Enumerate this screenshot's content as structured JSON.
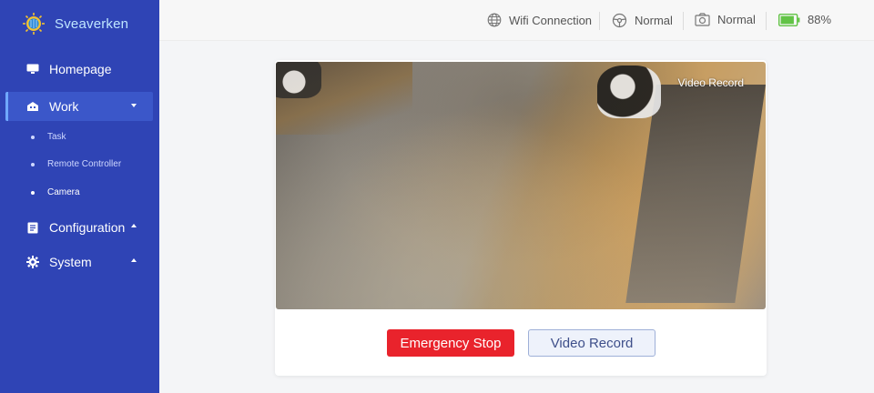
{
  "brand": {
    "name": "Sveaverken"
  },
  "sidebar": {
    "items": [
      {
        "label": "Homepage",
        "icon": "monitor-icon"
      },
      {
        "label": "Work",
        "icon": "robot-icon",
        "expanded": true,
        "children": [
          {
            "label": "Task"
          },
          {
            "label": "Remote Controller"
          },
          {
            "label": "Camera"
          }
        ]
      },
      {
        "label": "Configuration",
        "icon": "document-icon"
      },
      {
        "label": "System",
        "icon": "gear-icon"
      }
    ]
  },
  "header": {
    "wifi": {
      "label": "Wifi Connection",
      "icon": "globe-icon"
    },
    "status1": {
      "label": "Normal",
      "icon": "steering-wheel-icon"
    },
    "status2": {
      "label": "Normal",
      "icon": "camera-icon"
    },
    "battery": {
      "label": "88%",
      "icon": "battery-icon",
      "level": 88,
      "color": "#62c346"
    }
  },
  "video": {
    "overlay_label": "Video Record"
  },
  "buttons": {
    "emergency_stop": "Emergency Stop",
    "video_record": "Video Record"
  },
  "colors": {
    "sidebar": "#2f44b5",
    "stop": "#e9232c",
    "accent": "#6fa8ff"
  }
}
